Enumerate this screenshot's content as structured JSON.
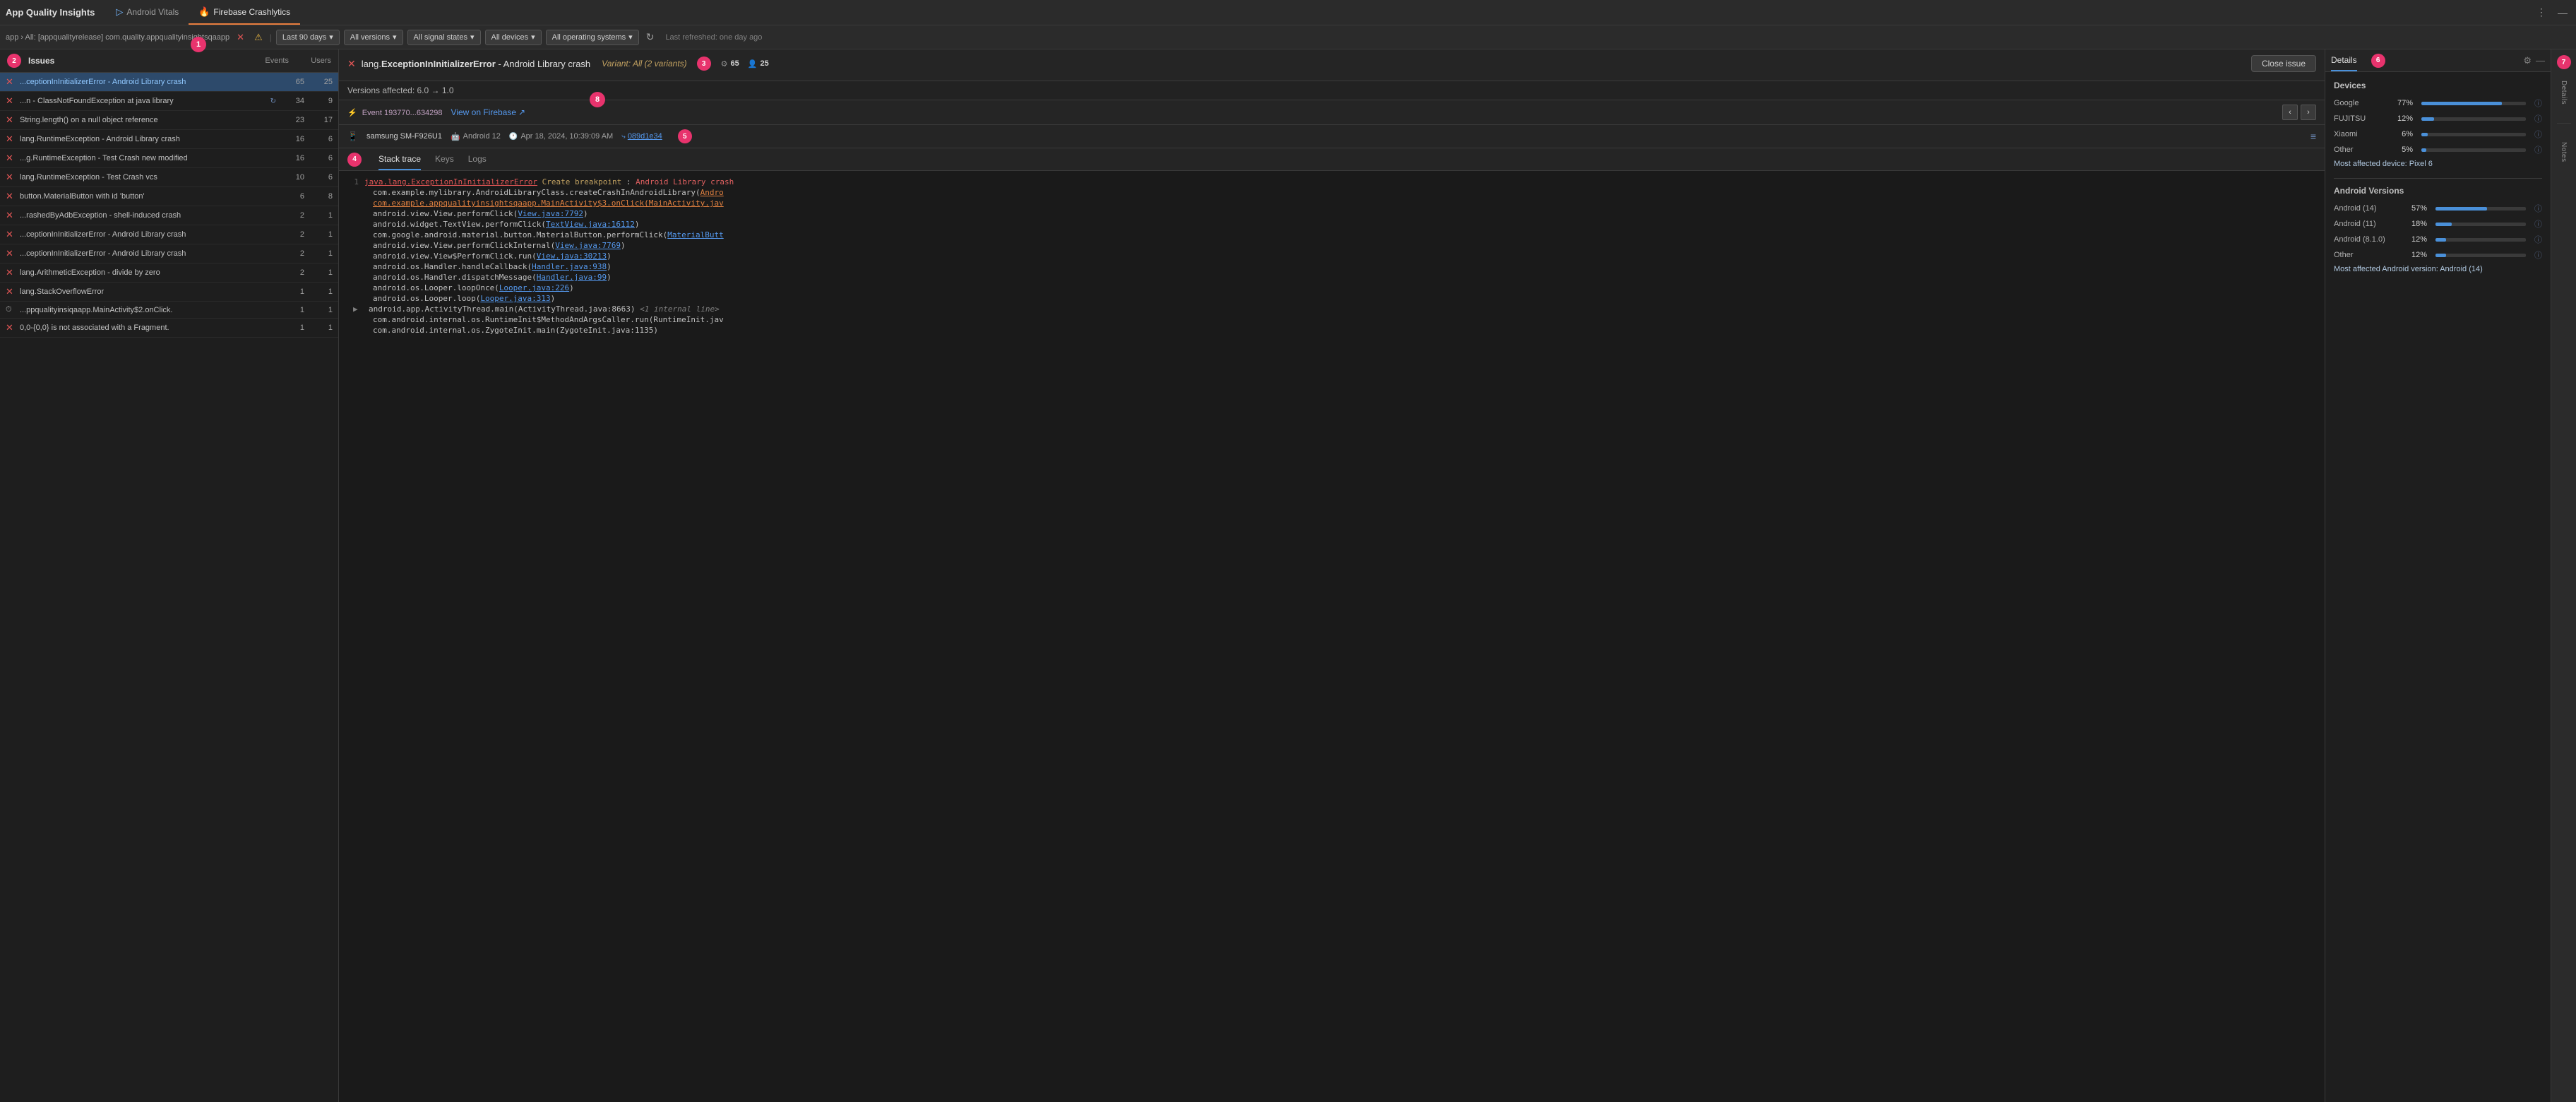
{
  "header": {
    "app_title": "App Quality Insights",
    "tabs": [
      {
        "id": "android-vitals",
        "label": "Android Vitals",
        "icon": "▷",
        "active": false
      },
      {
        "id": "firebase-crashlytics",
        "label": "Firebase Crashlytics",
        "icon": "🔥",
        "active": true
      }
    ],
    "more_icon": "⋮",
    "minimize_icon": "—"
  },
  "filter_bar": {
    "breadcrumb": "app › All: [appqualityrelease] com.quality.appqualityinsightsqaapp",
    "filters": [
      {
        "label": "Last 90 days",
        "id": "time"
      },
      {
        "label": "All versions",
        "id": "versions"
      },
      {
        "label": "All signal states",
        "id": "signals"
      },
      {
        "label": "All devices",
        "id": "devices"
      },
      {
        "label": "All operating systems",
        "id": "os"
      }
    ],
    "refresh_icon": "↻",
    "last_refreshed": "Last refreshed: one day ago"
  },
  "issues_panel": {
    "label": "Issues",
    "col_events": "Events",
    "col_users": "Users",
    "items": [
      {
        "icon": "error",
        "text": "...ceptionInInitializerError - Android Library crash",
        "events": 65,
        "users": 25,
        "selected": true
      },
      {
        "icon": "error",
        "text": "...n - ClassNotFoundException at java library",
        "events": 34,
        "users": 9,
        "selected": false,
        "has_sync": true
      },
      {
        "icon": "error",
        "text": "String.length() on a null object reference",
        "events": 23,
        "users": 17,
        "selected": false
      },
      {
        "icon": "error",
        "text": "lang.RuntimeException - Android Library crash",
        "events": 16,
        "users": 6,
        "selected": false
      },
      {
        "icon": "error",
        "text": "...g.RuntimeException - Test Crash new modified",
        "events": 16,
        "users": 6,
        "selected": false
      },
      {
        "icon": "error",
        "text": "lang.RuntimeException - Test Crash vcs",
        "events": 10,
        "users": 6,
        "selected": false
      },
      {
        "icon": "error",
        "text": "button.MaterialButton with id 'button'",
        "events": 6,
        "users": 8,
        "selected": false
      },
      {
        "icon": "error",
        "text": "...rashedByAdbException - shell-induced crash",
        "events": 2,
        "users": 1,
        "selected": false
      },
      {
        "icon": "error",
        "text": "...ceptionInInitializerError - Android Library crash",
        "events": 2,
        "users": 1,
        "selected": false
      },
      {
        "icon": "error",
        "text": "...ceptionInInitializerError - Android Library crash",
        "events": 2,
        "users": 1,
        "selected": false
      },
      {
        "icon": "error",
        "text": "lang.ArithmeticException - divide by zero",
        "events": 2,
        "users": 1,
        "selected": false
      },
      {
        "icon": "error",
        "text": "lang.StackOverflowError",
        "events": 1,
        "users": 1,
        "selected": false
      },
      {
        "icon": "clock",
        "text": "...ppqualityinsiqaapp.MainActivity$2.onClick.",
        "events": 1,
        "users": 1,
        "selected": false
      },
      {
        "icon": "error",
        "text": "0,0-{0,0} is not associated with a Fragment.",
        "events": 1,
        "users": 1,
        "selected": false
      }
    ]
  },
  "detail_panel": {
    "issue_title_prefix": "lang.",
    "issue_class": "ExceptionInInitializerError",
    "issue_suffix": " - Android Library crash",
    "variant_label": "Variant: All (2 variants)",
    "events_count": 65,
    "users_count": 25,
    "versions_affected": "Versions affected: 6.0 → 1.0",
    "event_id": "Event 193770...634298",
    "view_on_firebase": "View on Firebase",
    "close_issue": "Close issue",
    "device": "samsung SM-F926U1",
    "android_version": "Android 12",
    "date": "Apr 18, 2024, 10:39:09 AM",
    "commit_hash": "089d1e34",
    "tabs": [
      {
        "label": "Stack trace",
        "active": true
      },
      {
        "label": "Keys",
        "active": false
      },
      {
        "label": "Logs",
        "active": false
      }
    ],
    "stack_trace": [
      {
        "line": 1,
        "content_type": "error_first",
        "text": "java.lang.ExceptionInInitializerError Create breakpoint : Android Library crash",
        "indent": false,
        "expandable": false
      },
      {
        "line": null,
        "content_type": "normal",
        "text": "com.example.mylibrary.AndroidLibraryClass.createCrashInAndroidLibrary(Andro",
        "indent": true,
        "expandable": false
      },
      {
        "line": null,
        "content_type": "link",
        "text": "com.example.appqualityinsightsqaapp.MainActivity$3.onClick(MainActivity.jav",
        "indent": true,
        "expandable": false
      },
      {
        "line": null,
        "content_type": "normal",
        "text": "android.view.View.performClick(View.java:7792)",
        "indent": true,
        "expandable": false
      },
      {
        "line": null,
        "content_type": "normal",
        "text": "android.widget.TextView.performClick(TextView.java:16112)",
        "indent": true,
        "expandable": false
      },
      {
        "line": null,
        "content_type": "normal",
        "text": "com.google.android.material.button.MaterialButton.performClick(MaterialButt",
        "indent": true,
        "expandable": false
      },
      {
        "line": null,
        "content_type": "normal",
        "text": "android.view.View.performClickInternal(View.java:7769)",
        "indent": true,
        "expandable": false
      },
      {
        "line": null,
        "content_type": "normal",
        "text": "android.view.View$PerformClick.run(View.java:30213)",
        "indent": true,
        "expandable": false
      },
      {
        "line": null,
        "content_type": "normal",
        "text": "android.os.Handler.handleCallback(Handler.java:938)",
        "indent": true,
        "expandable": false
      },
      {
        "line": null,
        "content_type": "normal",
        "text": "android.os.Handler.dispatchMessage(Handler.java:99)",
        "indent": true,
        "expandable": false
      },
      {
        "line": null,
        "content_type": "normal",
        "text": "android.os.Looper.loopOnce(Looper.java:226)",
        "indent": true,
        "expandable": false
      },
      {
        "line": null,
        "content_type": "normal",
        "text": "android.os.Looper.loop(Looper.java:313)",
        "indent": true,
        "expandable": false
      },
      {
        "line": null,
        "content_type": "expandable",
        "text": "android.app.ActivityThread.main(ActivityThread.java:8663) <1 internal line>",
        "indent": true,
        "expandable": true
      },
      {
        "line": null,
        "content_type": "normal",
        "text": "com.android.internal.os.RuntimeInit$MethodAndArgsCaller.run(RuntimeInit.jav",
        "indent": true,
        "expandable": false
      },
      {
        "line": null,
        "content_type": "normal",
        "text": "com.android.internal.os.ZygoteInit.main(ZygoteInit.java:1135)",
        "indent": true,
        "expandable": false
      }
    ]
  },
  "right_panel": {
    "tab_details": "Details",
    "tab_notes": "Notes",
    "devices_title": "Devices",
    "devices": [
      {
        "name": "Google",
        "pct": 77,
        "label": "77%"
      },
      {
        "name": "FUJITSU",
        "pct": 12,
        "label": "12%"
      },
      {
        "name": "Xiaomi",
        "pct": 6,
        "label": "6%"
      },
      {
        "name": "Other",
        "pct": 5,
        "label": "5%"
      }
    ],
    "most_affected_device": "Most affected device: Pixel 6",
    "android_versions_title": "Android Versions",
    "android_versions": [
      {
        "name": "Android (14)",
        "pct": 57,
        "label": "57%"
      },
      {
        "name": "Android (11)",
        "pct": 18,
        "label": "18%"
      },
      {
        "name": "Android (8.1.0)",
        "pct": 12,
        "label": "12%"
      },
      {
        "name": "Other",
        "pct": 12,
        "label": "12%"
      }
    ],
    "most_affected_android": "Most affected Android version: Android (14)"
  },
  "side_icons": {
    "details_label": "Details",
    "notes_label": "Notes"
  },
  "badges": {
    "b1": "1",
    "b2": "2",
    "b3": "3",
    "b4": "4",
    "b5": "5",
    "b6": "6",
    "b7": "7",
    "b8": "8"
  }
}
